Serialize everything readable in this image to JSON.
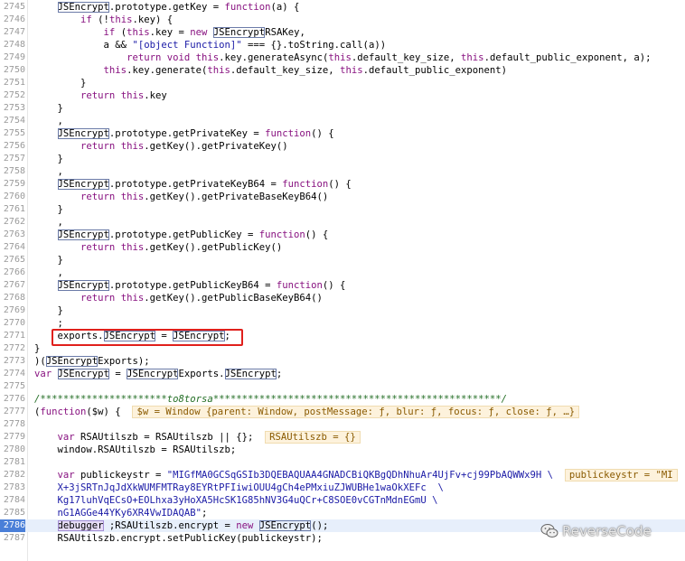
{
  "lines": [
    {
      "n": "2745",
      "segs": [
        [
          "",
          "    "
        ],
        [
          "hl",
          "JSEncrypt"
        ],
        [
          "",
          ".prototype.getKey = "
        ],
        [
          "kw",
          "function"
        ],
        [
          "",
          "(a) {"
        ]
      ]
    },
    {
      "n": "2746",
      "segs": [
        [
          "",
          "        "
        ],
        [
          "kw",
          "if"
        ],
        [
          "",
          " (!"
        ],
        [
          "kw",
          "this"
        ],
        [
          "",
          ".key) {"
        ]
      ]
    },
    {
      "n": "2747",
      "segs": [
        [
          "",
          "            "
        ],
        [
          "kw",
          "if"
        ],
        [
          "",
          " ("
        ],
        [
          "kw",
          "this"
        ],
        [
          "",
          ".key = "
        ],
        [
          "kw",
          "new"
        ],
        [
          "",
          " "
        ],
        [
          "hl",
          "JSEncrypt"
        ],
        [
          "",
          "RSAKey,"
        ]
      ]
    },
    {
      "n": "2748",
      "segs": [
        [
          "",
          "            a && "
        ],
        [
          "str",
          "\"[object Function]\""
        ],
        [
          "",
          " === {}.toString.call(a))"
        ]
      ]
    },
    {
      "n": "2749",
      "segs": [
        [
          "",
          "                "
        ],
        [
          "kw",
          "return"
        ],
        [
          "",
          " "
        ],
        [
          "kw",
          "void"
        ],
        [
          "",
          " "
        ],
        [
          "kw",
          "this"
        ],
        [
          "",
          ".key.generateAsync("
        ],
        [
          "kw",
          "this"
        ],
        [
          "",
          ".default_key_size, "
        ],
        [
          "kw",
          "this"
        ],
        [
          "",
          ".default_public_exponent, a);"
        ]
      ]
    },
    {
      "n": "2750",
      "segs": [
        [
          "",
          "            "
        ],
        [
          "kw",
          "this"
        ],
        [
          "",
          ".key.generate("
        ],
        [
          "kw",
          "this"
        ],
        [
          "",
          ".default_key_size, "
        ],
        [
          "kw",
          "this"
        ],
        [
          "",
          ".default_public_exponent)"
        ]
      ]
    },
    {
      "n": "2751",
      "segs": [
        [
          "",
          "        }"
        ]
      ]
    },
    {
      "n": "2752",
      "segs": [
        [
          "",
          "        "
        ],
        [
          "kw",
          "return"
        ],
        [
          "",
          " "
        ],
        [
          "kw",
          "this"
        ],
        [
          "",
          ".key"
        ]
      ]
    },
    {
      "n": "2753",
      "segs": [
        [
          "",
          "    }"
        ]
      ]
    },
    {
      "n": "2754",
      "segs": [
        [
          "",
          "    ,"
        ]
      ]
    },
    {
      "n": "2755",
      "segs": [
        [
          "",
          "    "
        ],
        [
          "hl",
          "JSEncrypt"
        ],
        [
          "",
          ".prototype.getPrivateKey = "
        ],
        [
          "kw",
          "function"
        ],
        [
          "",
          "() {"
        ]
      ]
    },
    {
      "n": "2756",
      "segs": [
        [
          "",
          "        "
        ],
        [
          "kw",
          "return"
        ],
        [
          "",
          " "
        ],
        [
          "kw",
          "this"
        ],
        [
          "",
          ".getKey().getPrivateKey()"
        ]
      ]
    },
    {
      "n": "2757",
      "segs": [
        [
          "",
          "    }"
        ]
      ]
    },
    {
      "n": "2758",
      "segs": [
        [
          "",
          "    ,"
        ]
      ]
    },
    {
      "n": "2759",
      "segs": [
        [
          "",
          "    "
        ],
        [
          "hl",
          "JSEncrypt"
        ],
        [
          "",
          ".prototype.getPrivateKeyB64 = "
        ],
        [
          "kw",
          "function"
        ],
        [
          "",
          "() {"
        ]
      ]
    },
    {
      "n": "2760",
      "segs": [
        [
          "",
          "        "
        ],
        [
          "kw",
          "return"
        ],
        [
          "",
          " "
        ],
        [
          "kw",
          "this"
        ],
        [
          "",
          ".getKey().getPrivateBaseKeyB64()"
        ]
      ]
    },
    {
      "n": "2761",
      "segs": [
        [
          "",
          "    }"
        ]
      ]
    },
    {
      "n": "2762",
      "segs": [
        [
          "",
          "    ,"
        ]
      ]
    },
    {
      "n": "2763",
      "segs": [
        [
          "",
          "    "
        ],
        [
          "hl",
          "JSEncrypt"
        ],
        [
          "",
          ".prototype.getPublicKey = "
        ],
        [
          "kw",
          "function"
        ],
        [
          "",
          "() {"
        ]
      ]
    },
    {
      "n": "2764",
      "segs": [
        [
          "",
          "        "
        ],
        [
          "kw",
          "return"
        ],
        [
          "",
          " "
        ],
        [
          "kw",
          "this"
        ],
        [
          "",
          ".getKey().getPublicKey()"
        ]
      ]
    },
    {
      "n": "2765",
      "segs": [
        [
          "",
          "    }"
        ]
      ]
    },
    {
      "n": "2766",
      "segs": [
        [
          "",
          "    ,"
        ]
      ]
    },
    {
      "n": "2767",
      "segs": [
        [
          "",
          "    "
        ],
        [
          "hl",
          "JSEncrypt"
        ],
        [
          "",
          ".prototype.getPublicKeyB64 = "
        ],
        [
          "kw",
          "function"
        ],
        [
          "",
          "() {"
        ]
      ]
    },
    {
      "n": "2768",
      "segs": [
        [
          "",
          "        "
        ],
        [
          "kw",
          "return"
        ],
        [
          "",
          " "
        ],
        [
          "kw",
          "this"
        ],
        [
          "",
          ".getKey().getPublicBaseKeyB64()"
        ]
      ]
    },
    {
      "n": "2769",
      "segs": [
        [
          "",
          "    }"
        ]
      ]
    },
    {
      "n": "2770",
      "segs": [
        [
          "",
          "    ;"
        ]
      ]
    },
    {
      "n": "2771",
      "segs": [
        [
          "",
          "    exports."
        ],
        [
          "hl",
          "JSEncrypt"
        ],
        [
          "",
          " = "
        ],
        [
          "hl",
          "JSEncrypt"
        ],
        [
          "",
          ";"
        ]
      ]
    },
    {
      "n": "2772",
      "segs": [
        [
          "",
          "}"
        ]
      ]
    },
    {
      "n": "2773",
      "segs": [
        [
          "",
          ")("
        ],
        [
          "hl",
          "JSEncrypt"
        ],
        [
          "",
          "Exports);"
        ]
      ]
    },
    {
      "n": "2774",
      "segs": [
        [
          "kw",
          "var"
        ],
        [
          "",
          " "
        ],
        [
          "hl",
          "JSEncrypt"
        ],
        [
          "",
          " = "
        ],
        [
          "hl",
          "JSEncrypt"
        ],
        [
          "",
          "Exports."
        ],
        [
          "hl",
          "JSEncrypt"
        ],
        [
          "",
          ";"
        ]
      ]
    },
    {
      "n": "2775",
      "segs": [
        [
          "",
          ""
        ]
      ]
    },
    {
      "n": "2776",
      "segs": [
        [
          "cmt",
          "/**********************to8torsa**************************************************/"
        ]
      ]
    },
    {
      "n": "2777",
      "segs": [
        [
          "",
          "("
        ],
        [
          "kw",
          "function"
        ],
        [
          "",
          "($w) {  "
        ],
        [
          "inline-val",
          "$w = Window {parent: Window, postMessage: ƒ, blur: ƒ, focus: ƒ, close: ƒ, …}"
        ]
      ]
    },
    {
      "n": "2778",
      "segs": [
        [
          "",
          ""
        ]
      ]
    },
    {
      "n": "2779",
      "segs": [
        [
          "",
          "    "
        ],
        [
          "kw",
          "var"
        ],
        [
          "",
          " RSAUtilszb = RSAUtilszb || {};  "
        ],
        [
          "inline-val",
          "RSAUtilszb = {}"
        ]
      ]
    },
    {
      "n": "2780",
      "segs": [
        [
          "",
          "    window.RSAUtilszb = RSAUtilszb;"
        ]
      ]
    },
    {
      "n": "2781",
      "segs": [
        [
          "",
          ""
        ]
      ]
    },
    {
      "n": "2782",
      "segs": [
        [
          "",
          "    "
        ],
        [
          "kw",
          "var"
        ],
        [
          "",
          " publickeystr = "
        ],
        [
          "str",
          "\"MIGfMA0GCSqGSIb3DQEBAQUAA4GNADCBiQKBgQDhNhuAr4UjFv+cj99PbAQWWx9H \\"
        ],
        [
          "",
          "  "
        ],
        [
          "inline-val",
          "publickeystr = \"MI"
        ]
      ]
    },
    {
      "n": "2783",
      "segs": [
        [
          "str",
          "    X+3jSRTnJqJdXkWUMFMTRay8EYRtPFIiwiOUU4gCh4ePMxiuZJWUBHe1waOkXEFc  \\"
        ]
      ]
    },
    {
      "n": "2784",
      "segs": [
        [
          "str",
          "    Kg17luhVqECsO+EOLhxa3yHoXA5HcSK1G85hNV3G4uQCr+C8SOE0vCGTnMdnEGmU \\"
        ]
      ]
    },
    {
      "n": "2785",
      "segs": [
        [
          "str",
          "    nG1AGGe44YKy6XR4VwIDAQAB\""
        ],
        [
          "",
          ";"
        ]
      ]
    },
    {
      "n": "2786",
      "exec": true,
      "segs": [
        [
          "",
          "    "
        ],
        [
          "bp",
          "debugger"
        ],
        [
          "",
          " ;RSAUtilszb.encrypt = "
        ],
        [
          "kw",
          "new"
        ],
        [
          "",
          " "
        ],
        [
          "hl",
          "JSEncrypt"
        ],
        [
          "",
          "();"
        ]
      ]
    },
    {
      "n": "2787",
      "segs": [
        [
          "",
          "    RSAUtilszb.encrypt.setPublicKey(publickeystr);"
        ]
      ]
    }
  ],
  "watermark": {
    "text": "ReverseCode"
  }
}
